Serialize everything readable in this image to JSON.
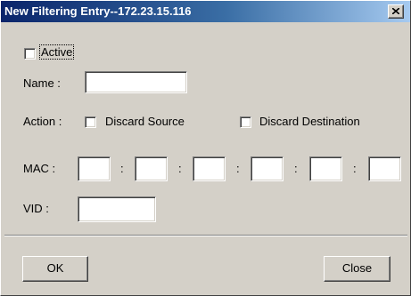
{
  "window": {
    "title": "New Filtering Entry--172.23.15.116",
    "close_glyph": "close-icon"
  },
  "form": {
    "active_label": "Active",
    "name_label": "Name :",
    "name_value": "",
    "action_label": "Action :",
    "discard_source_label": "Discard Source",
    "discard_destination_label": "Discard Destination",
    "mac_label": "MAC :",
    "mac_separator": ":",
    "mac_octets": [
      "",
      "",
      "",
      "",
      "",
      ""
    ],
    "vid_label": "VID :",
    "vid_value": ""
  },
  "buttons": {
    "ok_label": "OK",
    "close_label": "Close"
  }
}
